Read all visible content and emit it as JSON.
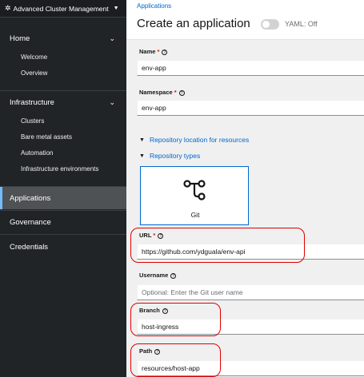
{
  "sidebar": {
    "switcher_label": "Advanced Cluster Management",
    "groups": [
      {
        "label": "Home",
        "items": [
          "Welcome",
          "Overview"
        ]
      },
      {
        "label": "Infrastructure",
        "items": [
          "Clusters",
          "Bare metal assets",
          "Automation",
          "Infrastructure environments"
        ]
      }
    ],
    "top_items": [
      "Applications",
      "Governance",
      "Credentials"
    ],
    "active": "Applications"
  },
  "header": {
    "breadcrumb": "Applications",
    "title": "Create an application",
    "yaml_toggle_label": "YAML: Off"
  },
  "form": {
    "name": {
      "label": "Name",
      "required": "*",
      "value": "env-app"
    },
    "namespace": {
      "label": "Namespace",
      "required": "*",
      "value": "env-app"
    },
    "repo_location_label": "Repository location for resources",
    "repo_types_label": "Repository types",
    "git_card_label": "Git",
    "url": {
      "label": "URL",
      "required": "*",
      "value": "https://github.com/ydguala/env-api"
    },
    "username": {
      "label": "Username",
      "placeholder": "Optional: Enter the Git user name"
    },
    "branch": {
      "label": "Branch",
      "value": "host-ingress"
    },
    "path": {
      "label": "Path",
      "value": "resources/host-app"
    }
  },
  "colors": {
    "sidebar_bg": "#212427",
    "link": "#0066cc",
    "highlight": "#e00000"
  }
}
